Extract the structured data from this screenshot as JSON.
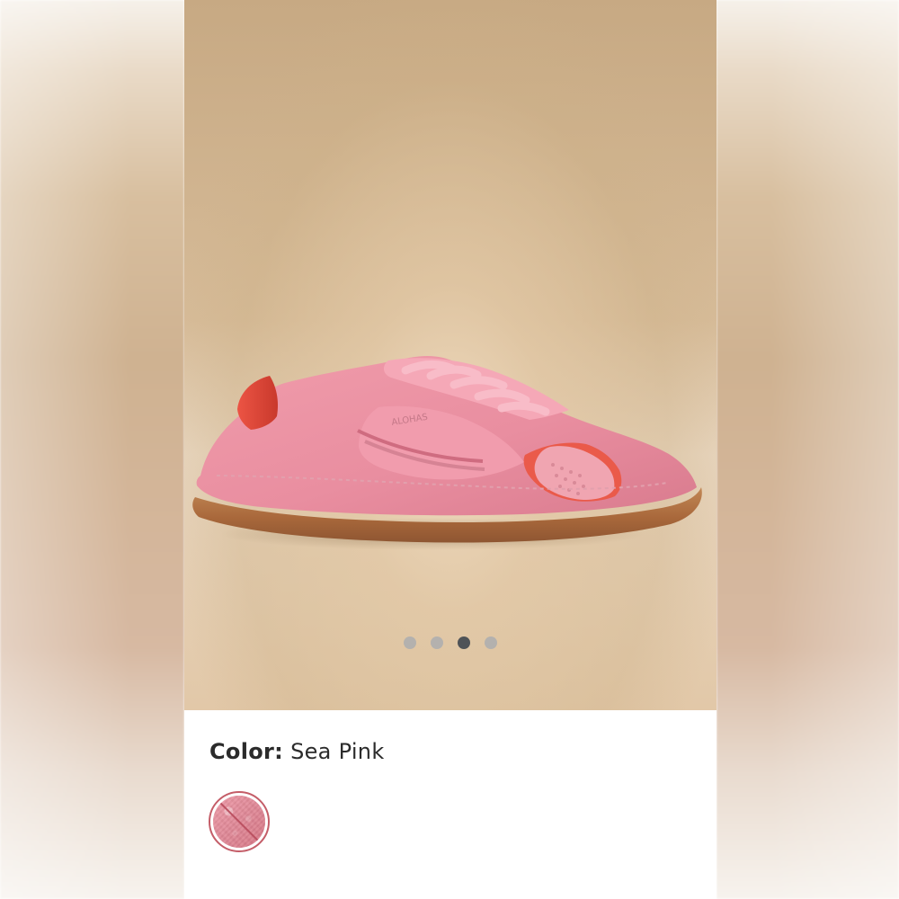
{
  "product": {
    "image_alt": "Pink suede sneaker with orange accents and gum sole",
    "brand_text": "ALOHAS"
  },
  "carousel": {
    "dot_count": 4,
    "active_index": 3
  },
  "selection": {
    "color_label": "Color:",
    "color_value": "Sea Pink"
  },
  "swatch": {
    "name": "Sea Pink",
    "state": "unavailable"
  },
  "colors": {
    "backdrop_light": "#f6f1ea",
    "backdrop_warm": "#d8bf9f",
    "card_bg": "#ffffff",
    "dot_inactive": "#a6abb1",
    "dot_active": "#4f5357",
    "text": "#2b2b2b",
    "swatch_ring": "#c45d68",
    "swatch_pink": "#e08897"
  },
  "icons": {
    "unavailable_indicator": "diagonal-slash-icon",
    "carousel_dot": "dot-icon"
  }
}
